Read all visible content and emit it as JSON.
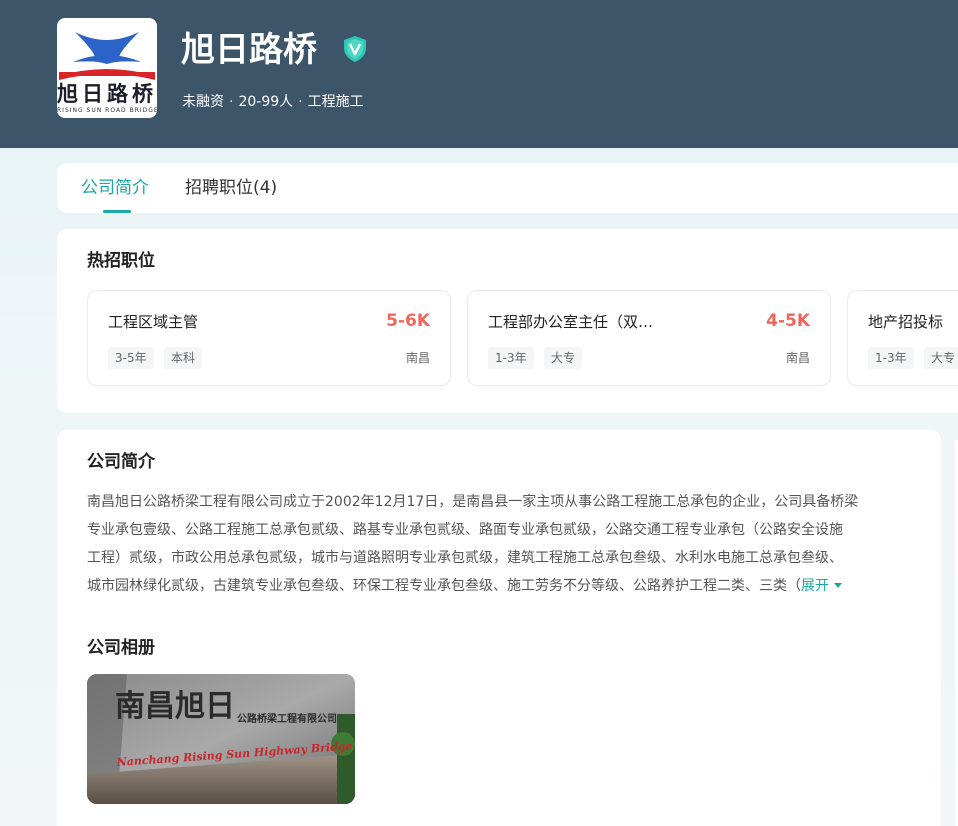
{
  "company": {
    "name": "旭日路桥",
    "logo_text": "旭日路桥",
    "logo_subtext": "RISING SUN ROAD BRIDGE",
    "funding": "未融资",
    "size": "20-99人",
    "industry": "工程施工",
    "verified_icon": "shield-v-icon"
  },
  "tabs": [
    {
      "label": "公司简介",
      "active": true
    },
    {
      "label": "招聘职位(4)",
      "active": false
    }
  ],
  "hot_jobs": {
    "title": "热招职位",
    "jobs": [
      {
        "title": "工程区域主管",
        "salary": "5-6K",
        "tags": [
          "3-5年",
          "本科"
        ],
        "city": "南昌"
      },
      {
        "title": "工程部办公室主任（双…",
        "salary": "4-5K",
        "tags": [
          "1-3年",
          "大专"
        ],
        "city": "南昌"
      },
      {
        "title": "地产招投标",
        "salary": "",
        "tags": [
          "1-3年",
          "大专"
        ],
        "city": ""
      }
    ]
  },
  "intro": {
    "title": "公司简介",
    "lines": [
      "南昌旭日公路桥梁工程有限公司成立于2002年12月17日，是南昌县一家主项从事公路工程施工总承包的企业，公司具备桥梁",
      "专业承包壹级、公路工程施工总承包贰级、路基专业承包贰级、路面专业承包贰级，公路交通工程专业承包（公路安全设施",
      "工程）贰级，市政公用总承包贰级，城市与道路照明专业承包贰级，建筑工程施工总承包叁级、水利水电施工总承包叁级、",
      "城市园林绿化贰级，古建筑专业承包叁级、环保工程专业承包叁级、施工劳务不分等级、公路养护工程二类、三类（"
    ],
    "expand_label": "展开"
  },
  "album": {
    "title": "公司相册",
    "photo_text_cn": "南昌旭日",
    "photo_text_cn_small": "公路桥梁工程有限公司",
    "photo_text_en": "Nanchang Rising Sun Highway Bridge Engineering Co.,Ltd"
  },
  "colors": {
    "header_bg": "#3d5569",
    "accent": "#18a9a5",
    "salary": "#f0665b"
  }
}
